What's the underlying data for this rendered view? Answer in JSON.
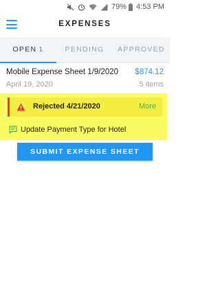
{
  "status_bar": {
    "battery": "79%",
    "time": "4:53 PM",
    "icons": [
      "mute-icon",
      "alarm-icon",
      "wifi-icon",
      "signal-icon",
      "battery-icon"
    ]
  },
  "app_bar": {
    "title": "EXPENSES",
    "menu_icon": "hamburger-icon"
  },
  "tabs": [
    {
      "label": "OPEN",
      "count": "1",
      "active": true
    },
    {
      "label": "PENDING",
      "active": false
    },
    {
      "label": "APPROVED",
      "active": false
    }
  ],
  "expense_sheet": {
    "title": "Mobile Expense Sheet 1/9/2020",
    "amount": "$874.12",
    "date": "April 19, 2020",
    "items": "5 items",
    "rejection": {
      "text": "Rejected 4/21/2020",
      "more": "More",
      "icon": "warning-icon"
    },
    "comment": {
      "text": "Update Payment Type for Hotel",
      "icon": "comment-icon"
    }
  },
  "submit_button": "SUBMIT EXPENSE SHEET",
  "colors": {
    "accent": "#2196f3",
    "highlight": "#fafa62",
    "reject_bar": "#e53935",
    "more_link": "#4caf50"
  }
}
